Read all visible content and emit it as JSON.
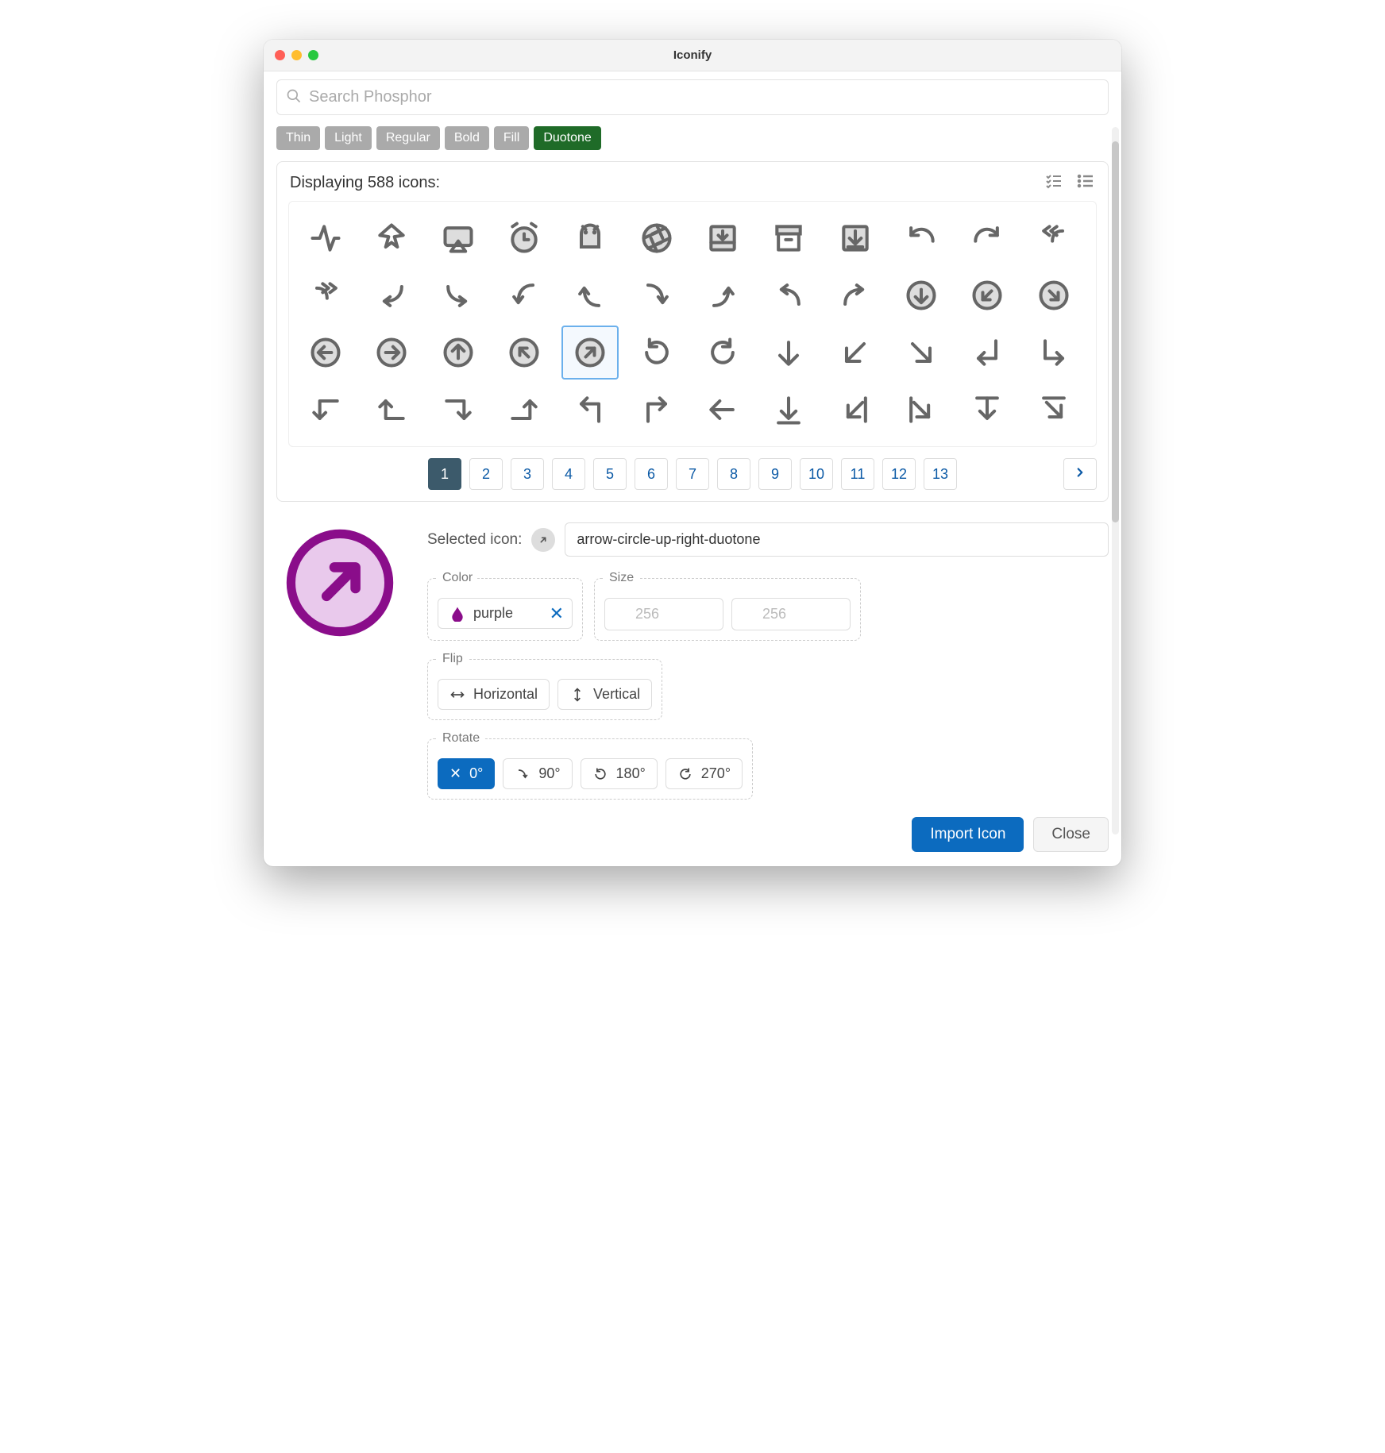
{
  "window": {
    "title": "Iconify"
  },
  "search": {
    "placeholder": "Search Phosphor"
  },
  "filters": [
    {
      "label": "Thin",
      "active": false
    },
    {
      "label": "Light",
      "active": false
    },
    {
      "label": "Regular",
      "active": false
    },
    {
      "label": "Bold",
      "active": false
    },
    {
      "label": "Fill",
      "active": false
    },
    {
      "label": "Duotone",
      "active": true
    }
  ],
  "results": {
    "heading": "Displaying 588 icons:",
    "pages": [
      "1",
      "2",
      "3",
      "4",
      "5",
      "6",
      "7",
      "8",
      "9",
      "10",
      "11",
      "12",
      "13"
    ],
    "current_page": "1",
    "selected_index": 28,
    "icons": [
      "activity",
      "airplane",
      "airplay",
      "alarm",
      "android-logo",
      "aperture",
      "archive-tray",
      "archive",
      "download-box",
      "arrow-arc-left",
      "arrow-arc-right",
      "arrows-bend-double-left",
      "arrows-bend-double-right",
      "arrow-bend-down-left",
      "arrow-bend-down-right",
      "arrow-bend-left-down",
      "arrow-bend-left-up",
      "arrow-bend-right-down",
      "arrow-bend-right-up",
      "arrow-bend-up-left",
      "arrow-bend-up-right",
      "arrow-circle-down",
      "arrow-circle-down-left",
      "arrow-circle-down-right",
      "arrow-circle-left",
      "arrow-circle-right",
      "arrow-circle-up",
      "arrow-circle-up-left",
      "arrow-circle-up-right",
      "arrow-clockwise",
      "arrow-counter-clockwise",
      "arrow-down",
      "arrow-down-left",
      "arrow-down-right",
      "arrow-elbow-down-left",
      "arrow-elbow-down-right",
      "arrow-elbow-left-down",
      "arrow-elbow-left-up",
      "arrow-elbow-right-down",
      "arrow-elbow-right-up",
      "arrow-elbow-up-left",
      "arrow-elbow-up-right",
      "arrow-left",
      "arrow-line-down",
      "arrow-line-down-left",
      "arrow-line-down-right",
      "arrow-fat-down",
      "arrow-fat-left"
    ]
  },
  "selected": {
    "label": "Selected icon:",
    "name": "arrow-circle-up-right-duotone",
    "color": {
      "legend": "Color",
      "value": "purple",
      "hex": "#8a0d8a",
      "fill": "#e9c9ec"
    },
    "size": {
      "legend": "Size",
      "width_placeholder": "256",
      "height_placeholder": "256"
    },
    "flip": {
      "legend": "Flip",
      "h_label": "Horizontal",
      "v_label": "Vertical"
    },
    "rotate": {
      "legend": "Rotate",
      "options": [
        {
          "label": "0°",
          "active": true
        },
        {
          "label": "90°",
          "active": false
        },
        {
          "label": "180°",
          "active": false
        },
        {
          "label": "270°",
          "active": false
        }
      ]
    }
  },
  "footer": {
    "import": "Import Icon",
    "close": "Close"
  }
}
